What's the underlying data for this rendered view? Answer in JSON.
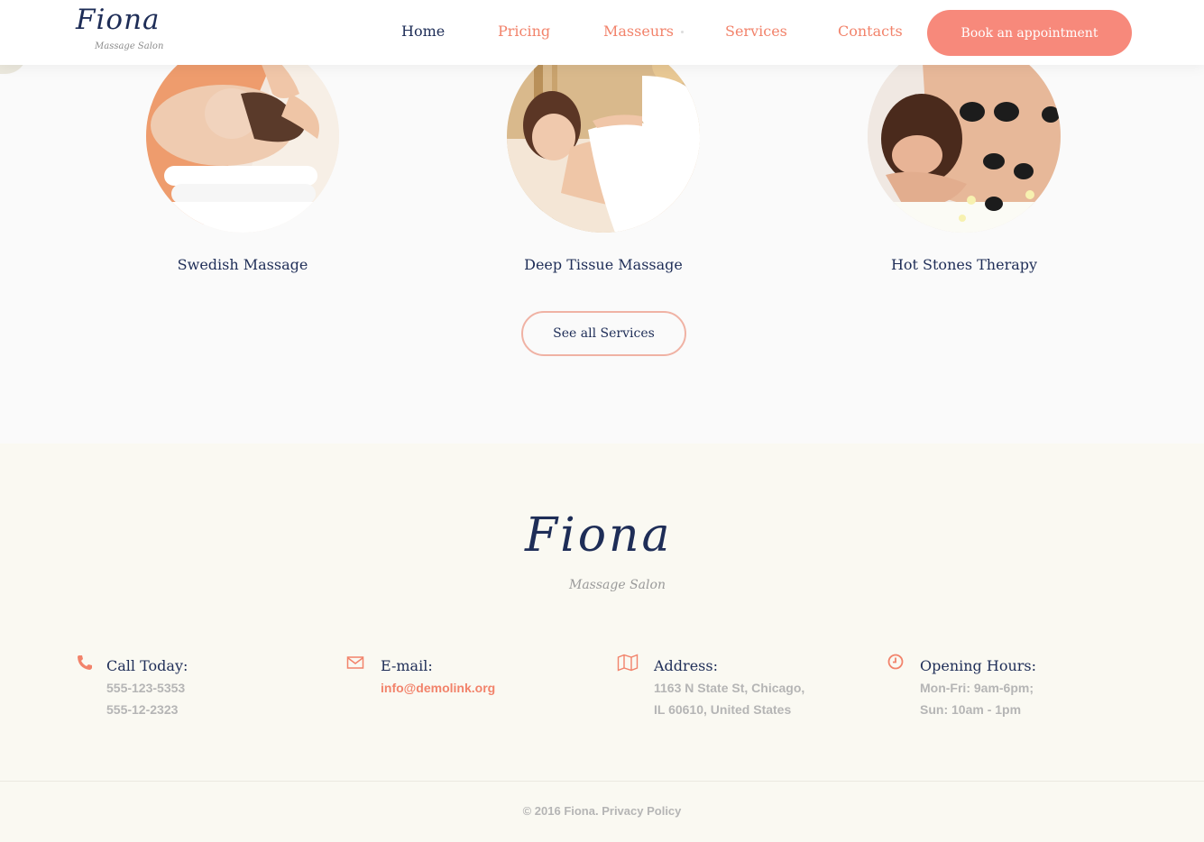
{
  "header": {
    "logo_script": "Fiona",
    "logo_tagline": "Massage Salon",
    "nav": [
      {
        "label": "Home"
      },
      {
        "label": "Pricing"
      },
      {
        "label": "Masseurs"
      },
      {
        "label": "Services"
      },
      {
        "label": "Contacts"
      }
    ],
    "cta_label": "Book an appointment"
  },
  "services": {
    "cards": [
      {
        "title": "Swedish Massage"
      },
      {
        "title": "Deep Tissue Massage"
      },
      {
        "title": "Hot Stones Therapy"
      }
    ],
    "see_all_label": "See all Services"
  },
  "footer": {
    "logo_script": "Fiona",
    "logo_tagline": "Massage Salon",
    "contacts": {
      "phone": {
        "title": "Call Today:",
        "lines": [
          "555-123-5353",
          "555-12-2323"
        ],
        "icon": "phone-icon"
      },
      "email": {
        "title": "E-mail:",
        "lines": [
          "info@demolink.org"
        ],
        "icon": "envelope-icon"
      },
      "address": {
        "title": "Address:",
        "lines": [
          "1163 N State St, Chicago,",
          "IL 60610, United States"
        ],
        "icon": "map-icon"
      },
      "hours": {
        "title": "Opening Hours:",
        "lines": [
          "Mon-Fri: 9am-6pm;",
          "Sun: 10am - 1pm"
        ],
        "icon": "clock-icon"
      }
    },
    "copyright": "© 2016 Fiona.",
    "privacy_label": "Privacy Policy"
  },
  "colors": {
    "accent": "#f7897b",
    "navy": "#1e2d57",
    "muted": "#b5b5b5"
  }
}
